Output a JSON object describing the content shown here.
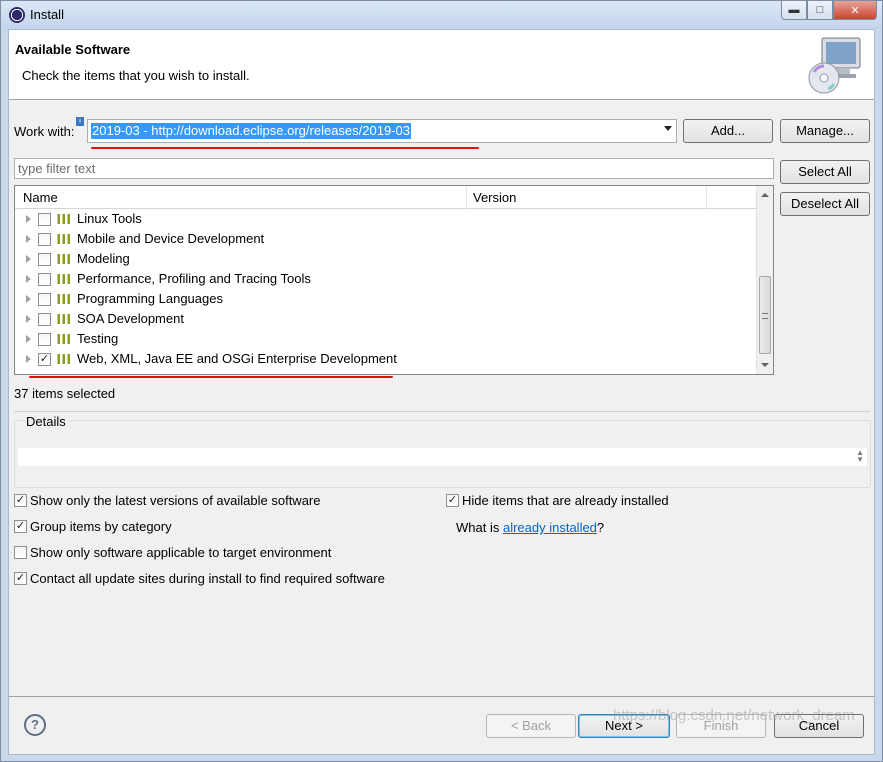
{
  "window": {
    "title": "Install",
    "controls": [
      "minimize",
      "maximize",
      "close"
    ]
  },
  "header": {
    "title": "Available Software",
    "description": "Check the items that you wish to install.",
    "image_icon": "install-disc-monitor-icon"
  },
  "work_with": {
    "label": "Work with:",
    "value": "2019-03 - http://download.eclipse.org/releases/2019-03",
    "add_button": "Add...",
    "manage_button": "Manage..."
  },
  "filter": {
    "placeholder": "type filter text"
  },
  "side_buttons": {
    "select_all": "Select All",
    "deselect_all": "Deselect All"
  },
  "tree": {
    "columns": [
      "Name",
      "Version"
    ],
    "rows": [
      {
        "label": "Linux Tools",
        "checked": false
      },
      {
        "label": "Mobile and Device Development",
        "checked": false
      },
      {
        "label": "Modeling",
        "checked": false
      },
      {
        "label": "Performance, Profiling and Tracing Tools",
        "checked": false
      },
      {
        "label": "Programming Languages",
        "checked": false
      },
      {
        "label": "SOA Development",
        "checked": false
      },
      {
        "label": "Testing",
        "checked": false
      },
      {
        "label": "Web, XML, Java EE and OSGi Enterprise Development",
        "checked": true
      }
    ]
  },
  "selected_count": "37 items selected",
  "details": {
    "legend": "Details"
  },
  "options": {
    "latest_versions": {
      "label": "Show only the latest versions of available software",
      "checked": true
    },
    "group_by_category": {
      "label": "Group items by category",
      "checked": true
    },
    "target_env": {
      "label": "Show only software applicable to target environment",
      "checked": false
    },
    "contact_sites": {
      "label": "Contact all update sites during install to find required software",
      "checked": true
    },
    "hide_installed": {
      "label": "Hide items that are already installed",
      "checked": true
    }
  },
  "what_is": {
    "prefix": "What is ",
    "link": "already installed",
    "suffix": "?"
  },
  "footer": {
    "back": "< Back",
    "next": "Next >",
    "finish": "Finish",
    "cancel": "Cancel",
    "watermark": "https://blog.csdn.net/network_dream"
  },
  "colors": {
    "selection": "#3399ff",
    "annotation_red": "#e01010",
    "link": "#0066cc"
  }
}
